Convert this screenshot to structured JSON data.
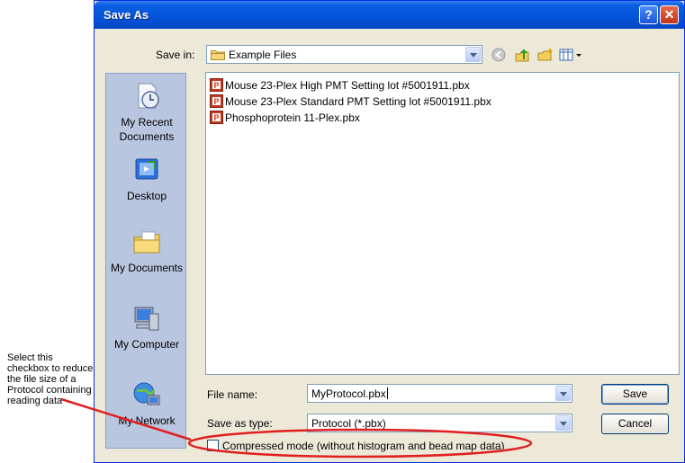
{
  "annotation": {
    "text": "Select this checkbox to reduce the file size of a Protocol containing reading data"
  },
  "window": {
    "title": "Save As",
    "help_icon": "question-mark",
    "close_icon": "x"
  },
  "save_in": {
    "label": "Save in:",
    "value": "Example Files"
  },
  "places": [
    {
      "label_line1": "My Recent",
      "label_line2": "Documents"
    },
    {
      "label_line1": "Desktop",
      "label_line2": ""
    },
    {
      "label_line1": "My Documents",
      "label_line2": ""
    },
    {
      "label_line1": "My Computer",
      "label_line2": ""
    },
    {
      "label_line1": "My Network",
      "label_line2": ""
    }
  ],
  "files": [
    "Mouse 23-Plex High PMT Setting lot #5001911.pbx",
    "Mouse 23-Plex Standard PMT Setting lot #5001911.pbx",
    "Phosphoprotein 11-Plex.pbx"
  ],
  "file_name": {
    "label": "File name:",
    "value": "MyProtocol.pbx"
  },
  "save_as_type": {
    "label": "Save as type:",
    "value": "Protocol (*.pbx)"
  },
  "buttons": {
    "save": "Save",
    "cancel": "Cancel"
  },
  "compressed": {
    "label": "Compressed mode (without histogram and bead map data)",
    "checked": false
  },
  "colors": {
    "titlebar": "#0553d9",
    "dialog_bg": "#ece9d8",
    "places_bg": "#b9c6e0",
    "highlight": "#e02020"
  }
}
